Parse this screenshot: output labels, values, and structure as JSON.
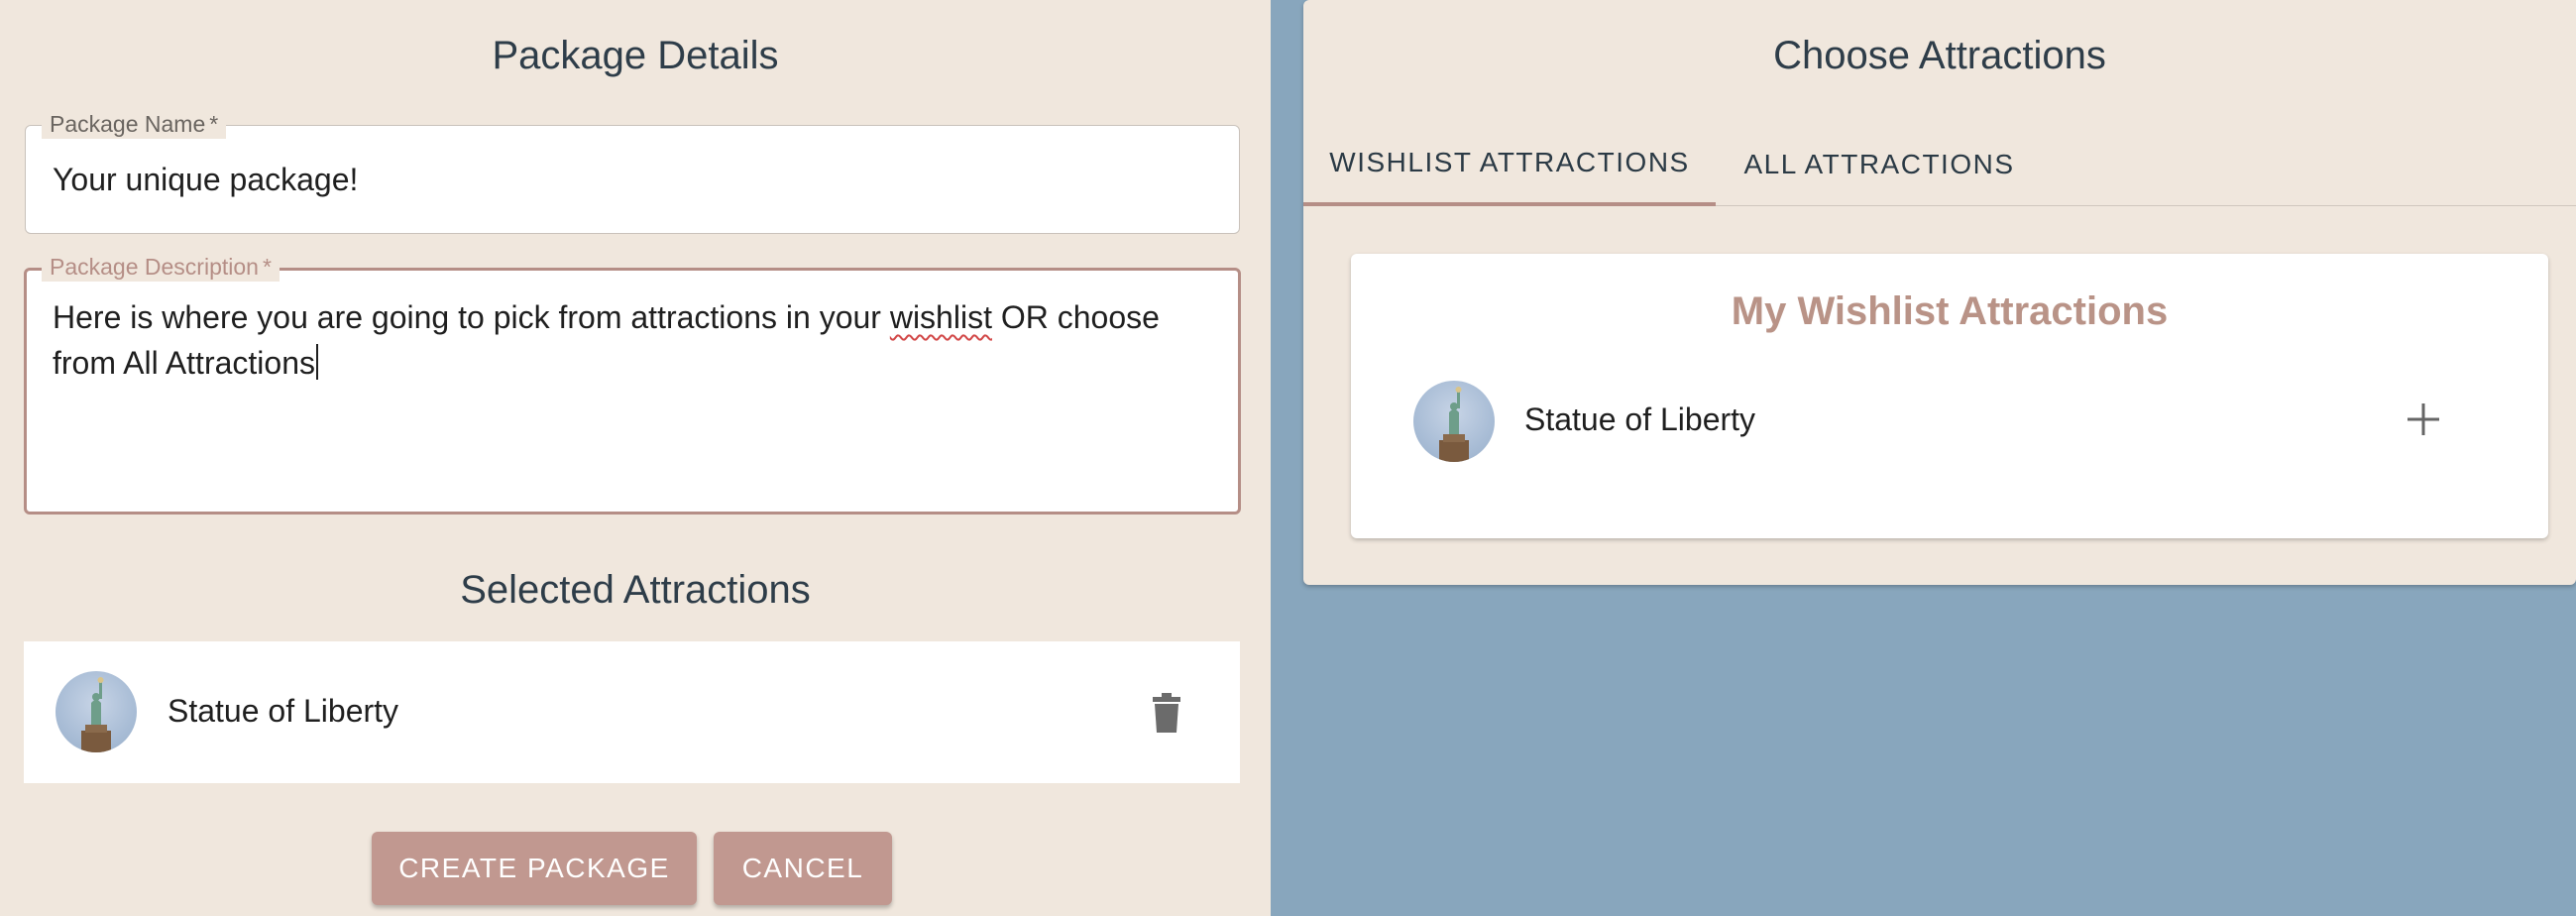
{
  "package_details": {
    "title": "Package Details",
    "name_field": {
      "label": "Package Name",
      "required_mark": "*",
      "value": "Your unique package!"
    },
    "description_field": {
      "label": "Package Description",
      "required_mark": "*",
      "value_before_flag": "Here is where you are going to pick from attractions in your ",
      "value_flagged": "wishlist",
      "value_after_flag": " OR choose from All Attractions"
    }
  },
  "selected_attractions": {
    "title": "Selected Attractions",
    "items": [
      {
        "name": "Statue of Liberty",
        "icon": "trash-icon"
      }
    ]
  },
  "actions": {
    "create_label": "CREATE PACKAGE",
    "cancel_label": "CANCEL"
  },
  "choose_attractions": {
    "title": "Choose Attractions",
    "tabs": [
      {
        "label": "WISHLIST ATTRACTIONS",
        "active": true
      },
      {
        "label": "ALL ATTRACTIONS",
        "active": false
      }
    ],
    "wishlist": {
      "title": "My Wishlist Attractions",
      "items": [
        {
          "name": "Statue of Liberty",
          "icon": "plus-icon"
        }
      ]
    }
  },
  "colors": {
    "panel_bg": "#f0e7dd",
    "page_bg": "#88a6bd",
    "accent": "#c19890",
    "accent_text": "#b99387"
  }
}
